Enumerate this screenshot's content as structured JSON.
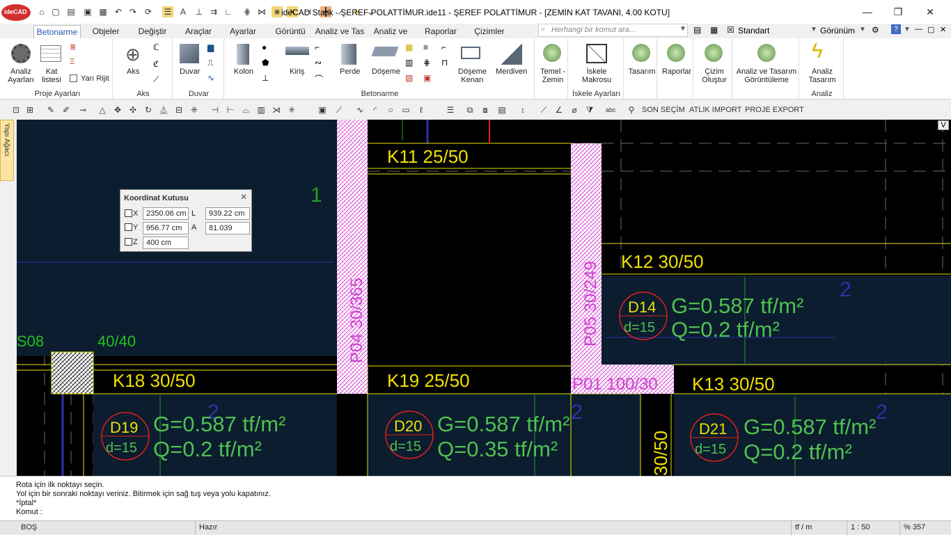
{
  "title_bar": {
    "app_badge": "ideCAD",
    "window_title": "ideCAD Statik - ŞEREF POLATTİMUR.ide11 - ŞEREF POLATTİMUR - [ZEMİN KAT TAVANI, 4.00 KOTU]",
    "min_glyph": "—",
    "max_glyph": "❐",
    "close_glyph": "✕"
  },
  "tabs": [
    "Betonarme",
    "Objeler",
    "Değiştir",
    "Araçlar",
    "Ayarlar",
    "Görüntü",
    "Analiz ve Tas",
    "Analiz ve Tas",
    "Raporlar",
    "Çizimler"
  ],
  "active_tab": "Betonarme",
  "search": {
    "placeholder": "Herhangi bir komut ara..."
  },
  "style_selector": {
    "value": "Standart"
  },
  "view_menu": {
    "label": "Görünüm"
  },
  "ribbon": {
    "proje": {
      "analiz": "Analiz\nAyarları",
      "kat": "Kat\nlistesi",
      "yari_rijit": "Yarı Rijit",
      "group": "Proje Ayarları"
    },
    "aks": {
      "label": "Aks",
      "group": "Aks"
    },
    "duvar": {
      "label": "Duvar",
      "group": "Duvar"
    },
    "betonarme": {
      "kolon": "Kolon",
      "kiris": "Kiriş",
      "perde": "Perde",
      "doseme": "Döşeme",
      "doseme_kenari": "Döşeme\nKenarı",
      "merdiven": "Merdiven",
      "group": "Betonarme"
    },
    "temel": {
      "label": "Temel -\nZemin"
    },
    "iskele": {
      "label": "İskele\nMakrosu",
      "group": "İskele Ayarları"
    },
    "tasarim": {
      "label": "Tasarım"
    },
    "raporlar": {
      "label": "Raporlar"
    },
    "cizim": {
      "label": "Çizim\nOluştur"
    },
    "analiz_gor": {
      "label": "Analiz ve Tasarım\nGörüntüleme"
    },
    "analiz_tas": {
      "label": "Analiz\nTasarım",
      "group": "Analiz"
    }
  },
  "toolbar2": {
    "son_secim": "SON SEÇİM",
    "atlik_import": "ATLIK IMPORT",
    "proje_export": "PROJE EXPORT"
  },
  "side_panel": {
    "label": "Yapı Ağacı"
  },
  "canvas": {
    "labels": {
      "k11": "K11 25/50",
      "k12": "K12   30/50",
      "k13": "K13   30/50",
      "k18": "K18   30/50",
      "k19": "K19 25/50",
      "s08": "S08",
      "s08_size": "40/40",
      "p04": "P04  30/365",
      "p05": "P05  30/249",
      "p01": "P01 100/30",
      "axis1": "1",
      "axis2": "2",
      "col_left": "30/50",
      "d14": "D14",
      "d19": "D19",
      "d20": "D20",
      "d21": "D21",
      "thick": "d=15",
      "g_val": "G=0.587 tf/m²",
      "q_02": "Q=0.2 tf/m²",
      "q_035": "Q=0.35 tf/m²"
    },
    "corner_button": "V"
  },
  "koordinat": {
    "title": "Koordinat Kutusu",
    "x_label": "X",
    "y_label": "Y",
    "z_label": "Z",
    "l_label": "L",
    "a_label": "A",
    "x": "2350.06 cm",
    "y": "956.77 cm",
    "z": "400 cm",
    "l": "939.22 cm",
    "a": "81.039"
  },
  "command": {
    "lines": [
      "Rota için ilk noktayı seçin.",
      "Yol için bir sonraki noktayı veriniz. Bitirmek için sağ tuş veya yolu kapatınız.",
      "*İptal*",
      "Komut :"
    ]
  },
  "status": {
    "left": "BOŞ",
    "ready": "Hazır",
    "unit": "tf / m",
    "scale": "1 : 50",
    "zoom": "% 357"
  }
}
